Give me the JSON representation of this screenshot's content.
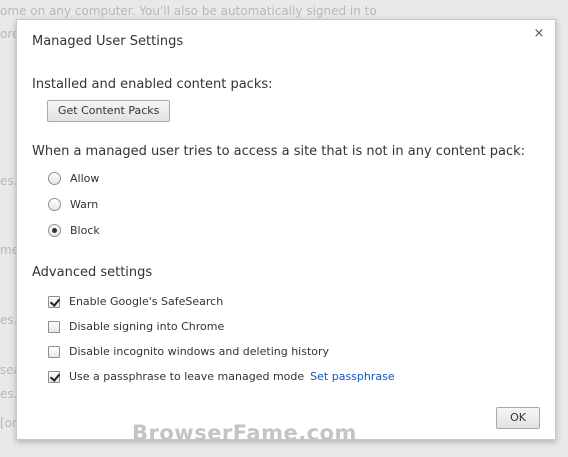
{
  "background": {
    "top_text": "ome on any computer. You'll also be automatically signed in to",
    "left_fragments": [
      "ore",
      "es.",
      "me",
      "es.",
      "sea",
      "es.",
      "[on"
    ]
  },
  "dialog": {
    "title": "Managed User Settings",
    "close_glyph": "×",
    "content_packs": {
      "label": "Installed and enabled content packs:",
      "button": "Get Content Packs"
    },
    "access": {
      "label": "When a managed user tries to access a site that is not in any content pack:",
      "options": [
        {
          "label": "Allow",
          "checked": false
        },
        {
          "label": "Warn",
          "checked": false
        },
        {
          "label": "Block",
          "checked": true
        }
      ]
    },
    "advanced": {
      "label": "Advanced settings",
      "options": [
        {
          "label": "Enable Google's SafeSearch",
          "checked": true
        },
        {
          "label": "Disable signing into Chrome",
          "checked": false
        },
        {
          "label": "Disable incognito windows and deleting history",
          "checked": false
        },
        {
          "label": "Use a passphrase to leave managed mode",
          "checked": true,
          "link": "Set passphrase"
        }
      ]
    },
    "ok_button": "OK"
  },
  "watermark": "BrowserFame.com"
}
